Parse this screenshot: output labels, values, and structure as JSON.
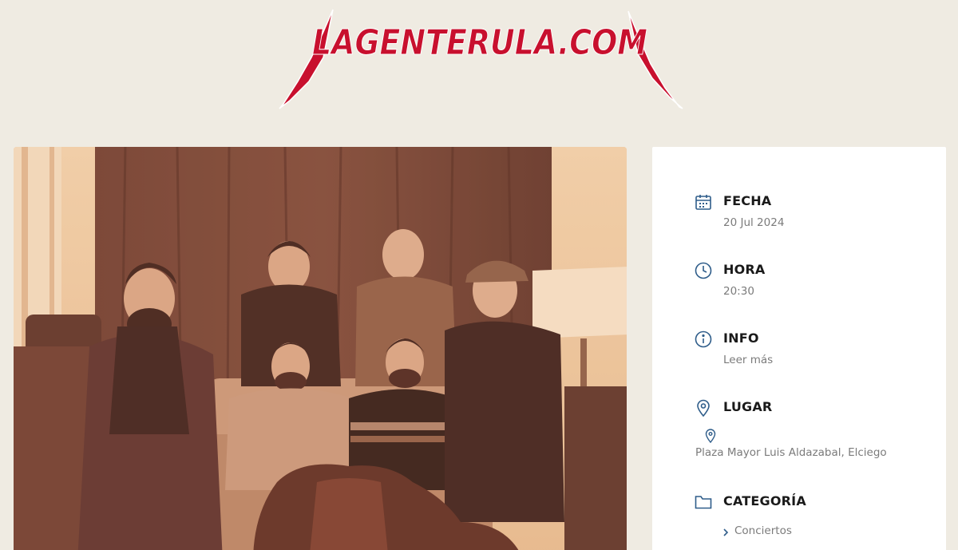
{
  "site": {
    "logo_text": "LAGENTERULA.COM",
    "logo_color": "#c8102e"
  },
  "event_photo": {
    "alt": "Foto del grupo"
  },
  "event_info": {
    "date": {
      "label": "FECHA",
      "value": "20 Jul 2024",
      "icon": "calendar-icon"
    },
    "time": {
      "label": "HORA",
      "value": "20:30",
      "icon": "clock-icon"
    },
    "info": {
      "label": "INFO",
      "value": "Leer más",
      "icon": "info-icon"
    },
    "place": {
      "label": "LUGAR",
      "value": "Plaza Mayor Luis Aldazabal, Elciego",
      "icon": "location-pin-icon"
    },
    "category": {
      "label": "CATEGORÍA",
      "value": "Conciertos",
      "icon": "folder-icon"
    }
  },
  "colors": {
    "background": "#efebe2",
    "icon_blue": "#2f5d8a",
    "text_muted": "#7b7b7b"
  }
}
